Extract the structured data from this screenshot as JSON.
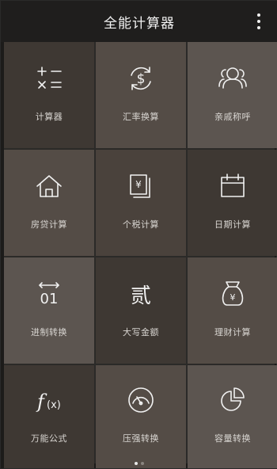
{
  "app": {
    "title": "全能计算器"
  },
  "tiles": [
    {
      "label": "计算器",
      "icon": "calculator-icon"
    },
    {
      "label": "汇率换算",
      "icon": "currency-exchange-icon"
    },
    {
      "label": "亲戚称呼",
      "icon": "family-icon"
    },
    {
      "label": "房贷计算",
      "icon": "house-icon"
    },
    {
      "label": "个税计算",
      "icon": "tax-document-icon"
    },
    {
      "label": "日期计算",
      "icon": "calendar-icon"
    },
    {
      "label": "进制转换",
      "icon": "binary-icon"
    },
    {
      "label": "大写金额",
      "icon": "chinese-numeral-icon"
    },
    {
      "label": "理财计算",
      "icon": "money-bag-icon"
    },
    {
      "label": "万能公式",
      "icon": "formula-icon"
    },
    {
      "label": "压强转换",
      "icon": "gauge-icon"
    },
    {
      "label": "容量转换",
      "icon": "pie-chart-icon"
    }
  ],
  "icon_glyphs": {
    "currency": "$",
    "tax": "¥",
    "numeral": "贰",
    "binary": "01",
    "formula_f": "f",
    "formula_x": "(x)",
    "bag": "¥"
  },
  "pagination": {
    "total": 2,
    "active": 1
  },
  "colors": {
    "topbar": "#1f1e1d",
    "tile_dark": "#3e3833",
    "tile_mid": "#4a423c",
    "tile_light": "#5c5550",
    "icon_stroke": "#f1f1f1",
    "label": "#d9d6d2"
  }
}
